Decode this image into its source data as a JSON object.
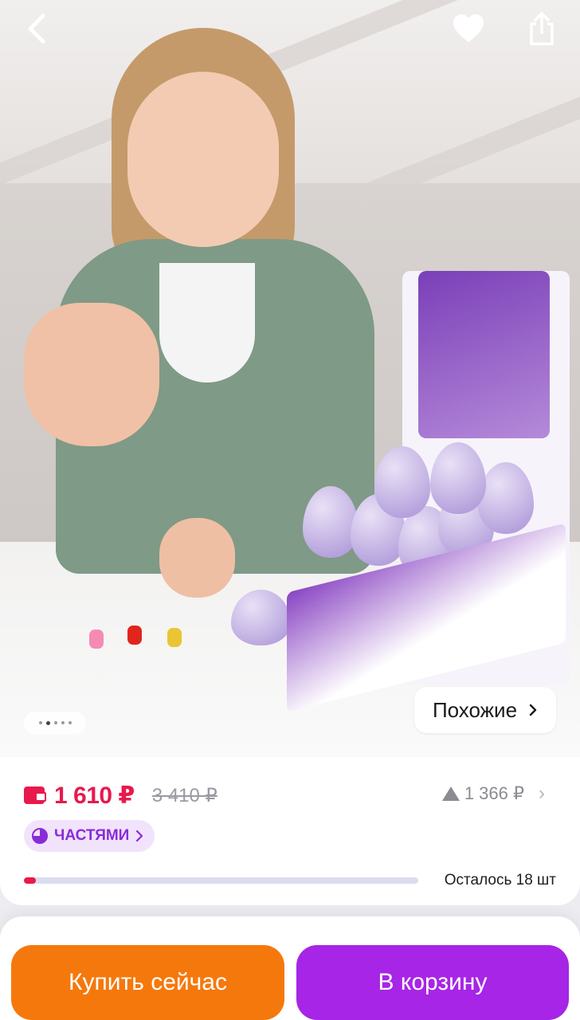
{
  "gallery": {
    "similar_label": "Похожие",
    "dots_total": 5,
    "dots_active_index": 1
  },
  "price": {
    "current": "1 610 ₽",
    "old": "3 410 ₽",
    "alt_price": "1 366 ₽",
    "accent_color": "#e8194d"
  },
  "installments": {
    "label": "ЧАСТЯМИ",
    "color": "#8a2bd8"
  },
  "stock": {
    "remaining_text": "Осталось 18 шт",
    "remaining_fraction": 0.03
  },
  "actions": {
    "buy_now": "Купить сейчас",
    "add_to_cart": "В корзину",
    "buy_color": "#f5780c",
    "cart_color": "#a625e6"
  }
}
